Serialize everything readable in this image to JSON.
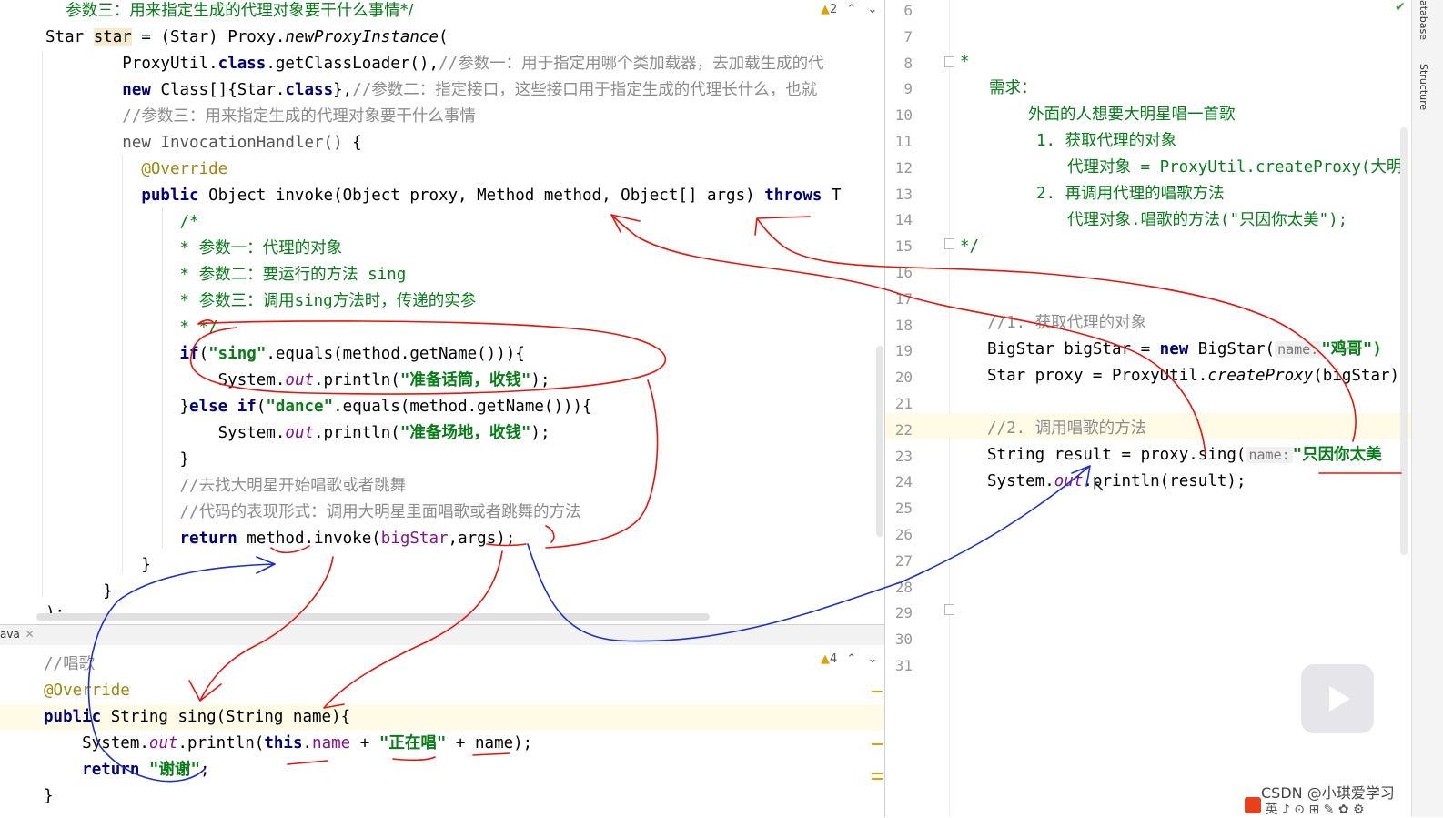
{
  "top_editor": {
    "warning_count": "2",
    "lines": [
      "    参数三：用来指定生成的代理对象要干什么事情*/",
      "Star star = (Star) Proxy.newProxyInstance(",
      "        ProxyUtil.class.getClassLoader(),//参数一：用于指定用哪个类加载器，去加载生成的代",
      "        new Class[]{Star.class},//参数二：指定接口，这些接口用于指定生成的代理长什么，也就",
      "        //参数三：用来指定生成的代理对象要干什么事情",
      "        new InvocationHandler() {",
      "            @Override",
      "            public Object invoke(Object proxy, Method method, Object[] args) throws T",
      "                /*",
      "                * 参数一：代理的对象",
      "                * 参数二：要运行的方法 sing",
      "                * 参数三：调用sing方法时，传递的实参",
      "                * */",
      "                if(\"sing\".equals(method.getName())){",
      "                    System.out.println(\"准备话筒，收钱\");",
      "                }else if(\"dance\".equals(method.getName())){",
      "                    System.out.println(\"准备场地，收钱\");",
      "                }",
      "                //去找大明星开始唱歌或者跳舞",
      "                //代码的表现形式：调用大明星里面唱歌或者跳舞的方法",
      "                return method.invoke(bigStar,args);",
      "            }",
      "        }",
      ");"
    ]
  },
  "bottom_editor": {
    "tab_label": "ava",
    "warning_count": "4",
    "lines": [
      "//唱歌",
      "@Override",
      "public String sing(String name){",
      "    System.out.println(this.name + \"正在唱\" + name);",
      "    return \"谢谢\";",
      "}"
    ]
  },
  "right_editor": {
    "line_numbers": [
      "6",
      "7",
      "8",
      "9",
      "10",
      "11",
      "12",
      "13",
      "14",
      "15",
      "16",
      "17",
      "18",
      "19",
      "20",
      "21",
      "22",
      "23",
      "24",
      "25",
      "26",
      "27",
      "28",
      "29",
      "30",
      "31"
    ],
    "comment_lines": [
      "*",
      "需求：",
      "外面的人想要大明星唱一首歌",
      "1. 获取代理的对象",
      "代理对象 = ProxyUtil.createProxy(大明",
      "2. 再调用代理的唱歌方法",
      "代理对象.唱歌的方法(\"只因你太美\");",
      "*/"
    ],
    "code": {
      "c1": "//1. 获取代理的对象",
      "l19_a": "BigStar bigStar = ",
      "l19_kw": "new",
      "l19_b": " BigStar(",
      "l19_hint": "name:",
      "l19_str": "\"鸡哥\")",
      "l20_a": "Star proxy = ProxyUtil.",
      "l20_m": "createProxy",
      "l20_b": "(bigStar)",
      "c2": "//2. 调用唱歌的方法",
      "l23_a": "String result = proxy.sing(",
      "l23_hint": "name:",
      "l23_str": "\"只因你太美",
      "l24_a": "System.",
      "l24_f": "out",
      "l24_b": ".println(result);"
    }
  },
  "side_tabs": {
    "database": "atabase",
    "structure": "Structure"
  },
  "watermark": "CSDN @小琪爱学习",
  "colors": {
    "annotation_red": "#e8140c",
    "annotation_blue": "#1a2fd0",
    "keyword": "#000080",
    "string": "#067d17",
    "comment": "#8c8c8c"
  }
}
